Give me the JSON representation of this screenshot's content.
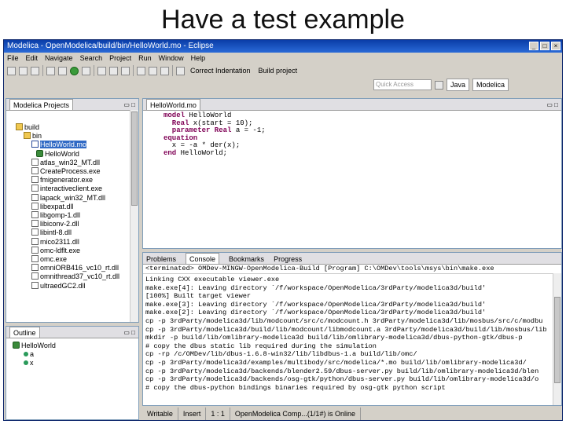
{
  "slide": {
    "title": "Have a test example"
  },
  "window": {
    "title": "Modelica - OpenModelica/build/bin/HelloWorld.mo - Eclipse"
  },
  "menu": [
    "File",
    "Edit",
    "Navigate",
    "Search",
    "Project",
    "Run",
    "Window",
    "Help"
  ],
  "toolbar": {
    "correct_indentation": "Correct Indentation",
    "build_project": "Build project",
    "quick_access": "Quick Access",
    "perspective_java": "Java",
    "perspective_modelica": "Modelica"
  },
  "projects": {
    "tab": "Modelica Projects",
    "items": [
      {
        "label": "build",
        "icon": "folder-icon"
      },
      {
        "label": "bin",
        "icon": "folder-icon"
      },
      {
        "label": "HelloWorld.mo",
        "icon": "modelica-file-icon"
      },
      {
        "label": "HelloWorld",
        "icon": "model-icon"
      },
      {
        "label": "atlas_win32_MT.dll",
        "icon": "file-icon"
      },
      {
        "label": "CreateProcess.exe",
        "icon": "file-icon"
      },
      {
        "label": "fmigenerator.exe",
        "icon": "file-icon"
      },
      {
        "label": "interactiveclient.exe",
        "icon": "file-icon"
      },
      {
        "label": "lapack_win32_MT.dll",
        "icon": "file-icon"
      },
      {
        "label": "libexpat.dll",
        "icon": "file-icon"
      },
      {
        "label": "libgomp-1.dll",
        "icon": "file-icon"
      },
      {
        "label": "libiconv-2.dll",
        "icon": "file-icon"
      },
      {
        "label": "libintl-8.dll",
        "icon": "file-icon"
      },
      {
        "label": "mico2311.dll",
        "icon": "file-icon"
      },
      {
        "label": "omc-ldflt.exe",
        "icon": "file-icon"
      },
      {
        "label": "omc.exe",
        "icon": "file-icon"
      },
      {
        "label": "omniORB416_vc10_rt.dll",
        "icon": "file-icon"
      },
      {
        "label": "omnithread37_vc10_rt.dll",
        "icon": "file-icon"
      },
      {
        "label": "ultraedGC2.dll",
        "icon": "file-icon"
      }
    ]
  },
  "outline": {
    "tab": "Outline",
    "items": [
      {
        "label": "HelloWorld",
        "icon": "model-icon"
      },
      {
        "label": "a",
        "icon": "variable-icon"
      },
      {
        "label": "x",
        "icon": "variable-icon"
      }
    ]
  },
  "editor": {
    "tab": "HelloWorld.mo",
    "lines": [
      {
        "kw": "model",
        "rest": " HelloWorld"
      },
      {
        "kw": "  Real",
        "rest": " x(start = 10);"
      },
      {
        "kw": "  parameter Real",
        "rest": " a = -1;"
      },
      {
        "kw": "equation",
        "rest": ""
      },
      {
        "kw": "",
        "rest": "  x = -a * der(x);"
      },
      {
        "kw": "end",
        "rest": " HelloWorld;"
      }
    ]
  },
  "bottom_tabs": [
    "Problems",
    "Console",
    "Bookmarks",
    "Progress"
  ],
  "console": {
    "header": "<terminated> OMDev-MINGW-OpenModelica-Build [Program] C:\\OMDev\\tools\\msys\\bin\\make.exe",
    "lines": [
      "Linking CXX executable viewer.exe",
      "make.exe[4]: Leaving directory `/f/workspace/OpenModelica/3rdParty/modelica3d/build'",
      "[100%] Built target viewer",
      "make.exe[3]: Leaving directory `/f/workspace/OpenModelica/3rdParty/modelica3d/build'",
      "make.exe[2]: Leaving directory `/f/workspace/OpenModelica/3rdParty/modelica3d/build'",
      "cp -p 3rdParty/modelica3d/lib/modcount/src/c/modcount.h 3rdParty/modelica3d/lib/mosbus/src/c/modbu",
      "cp -p 3rdParty/modelica3d/build/lib/modcount/libmodcount.a 3rdParty/modelica3d/build/lib/mosbus/lib",
      "mkdir -p build/lib/omlibrary-modelica3d build/lib/omlibrary-modelica3d/dbus-python-gtk/dbus-p",
      "# copy the dbus static lib required during the simulation",
      "cp -rp /c/OMDev/lib/dbus-1.6.8-win32/lib/libdbus-1.a build/lib/omc/",
      "cp -p 3rdParty/modelica3d/examples/multibody/src/modelica/*.mo build/lib/omlibrary-modelica3d/",
      "cp -p 3rdParty/modelica3d/backends/blender2.59/dbus-server.py build/lib/omlibrary-modelica3d/blen",
      "cp -p 3rdParty/modelica3d/backends/osg-gtk/python/dbus-server.py build/lib/omlibrary-modelica3d/o",
      "# copy the dbus-python bindings binaries required by osg-gtk python script"
    ]
  },
  "status": {
    "writable": "Writable",
    "insert": "Insert",
    "position": "1 : 1",
    "server": "OpenModelica Comp...(1/1#) is Online"
  }
}
